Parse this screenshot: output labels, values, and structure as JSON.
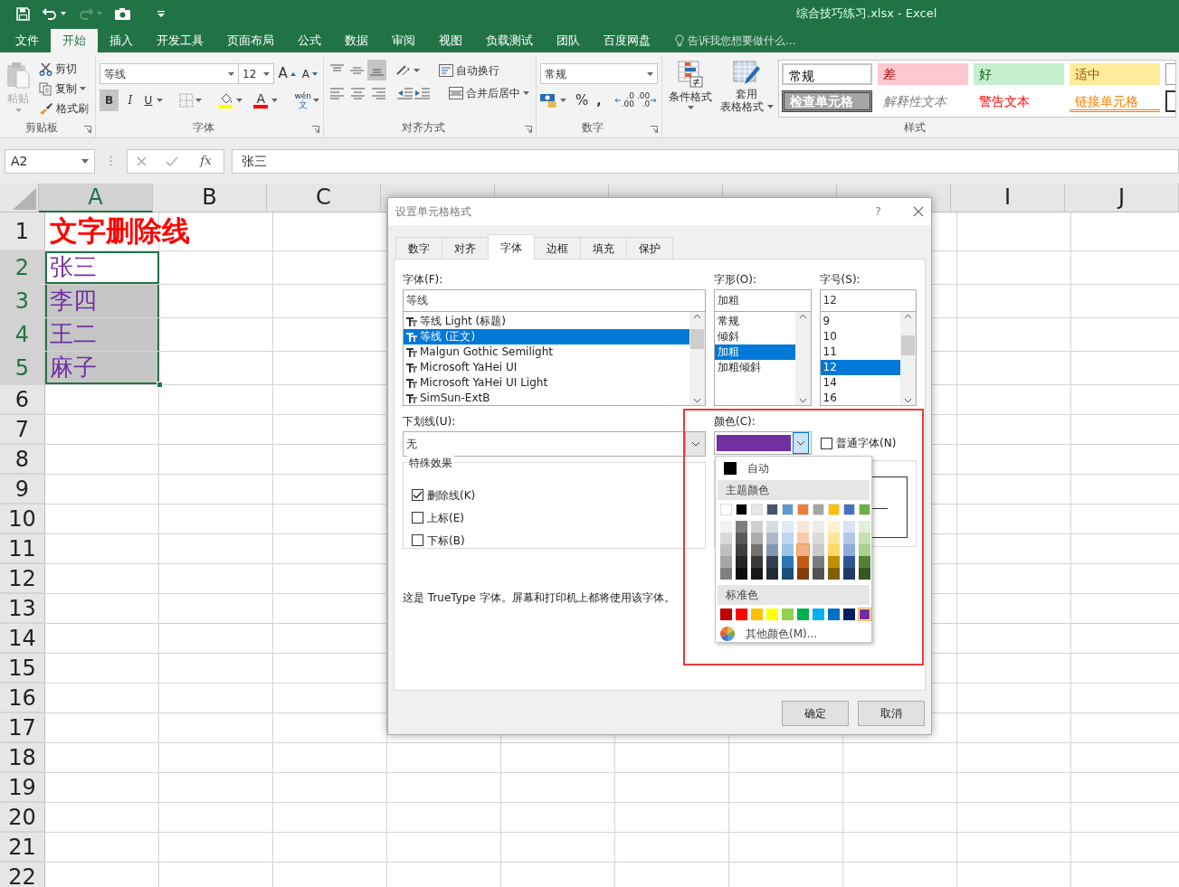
{
  "window": {
    "title": "综合技巧练习.xlsx - Excel"
  },
  "ribbon_tabs": [
    {
      "label": "文件",
      "selected": false
    },
    {
      "label": "开始",
      "selected": true
    },
    {
      "label": "插入",
      "selected": false
    },
    {
      "label": "开发工具",
      "selected": false
    },
    {
      "label": "页面布局",
      "selected": false
    },
    {
      "label": "公式",
      "selected": false
    },
    {
      "label": "数据",
      "selected": false
    },
    {
      "label": "审阅",
      "selected": false
    },
    {
      "label": "视图",
      "selected": false
    },
    {
      "label": "负载测试",
      "selected": false
    },
    {
      "label": "团队",
      "selected": false
    },
    {
      "label": "百度网盘",
      "selected": false
    }
  ],
  "tell_me": {
    "placeholder": "告诉我您想要做什么..."
  },
  "clipboard": {
    "label": "剪贴板",
    "paste": {
      "label": "粘贴",
      "disabled": true
    },
    "cut": "剪切",
    "copy": "复制",
    "format_painter": "格式刷"
  },
  "font_group": {
    "label": "字体",
    "font_name": "等线",
    "font_size": "12",
    "grow": "A",
    "shrink": "A",
    "bold": {
      "text": "B",
      "selected": true
    },
    "italic": {
      "text": "I",
      "selected": false
    },
    "underline": {
      "text": "U",
      "selected": false
    },
    "font_color": "A",
    "phonetic": {
      "pinyin": "wén",
      "character": "文"
    }
  },
  "alignment": {
    "label": "对齐方式",
    "vertical": [
      {
        "kind": "top",
        "selected": false
      },
      {
        "kind": "middle",
        "selected": false
      },
      {
        "kind": "bottom",
        "selected": true
      }
    ],
    "wrap_text": "自动换行",
    "merge_center": "合并后居中"
  },
  "number": {
    "label": "数字",
    "format": "常规",
    "percent": "%",
    "comma": ",",
    "increase_decimal": {
      "top": ".0",
      "bottom": ".00"
    },
    "decrease_decimal": {
      "top": ".00",
      "bottom": ".0"
    }
  },
  "styles": {
    "label": "样式",
    "conditional_formatting": "条件格式",
    "format_as_table": [
      "套用",
      "表格格式"
    ],
    "cells": [
      {
        "label": "常规",
        "kind": "normal"
      },
      {
        "label": "差",
        "kind": "bad"
      },
      {
        "label": "好",
        "kind": "good"
      },
      {
        "label": "适中",
        "kind": "neutral"
      },
      {
        "label": "检查单元格",
        "kind": "check"
      },
      {
        "label": "解释性文本",
        "kind": "explanatory"
      },
      {
        "label": "警告文本",
        "kind": "warning"
      },
      {
        "label": "链接单元格",
        "kind": "linked"
      }
    ]
  },
  "formula_bar": {
    "name_box": "A2",
    "function": "fx",
    "value": "张三"
  },
  "sheet": {
    "columns": [
      {
        "label": "A",
        "selected": true
      },
      {
        "label": "B",
        "selected": false
      },
      {
        "label": "C",
        "selected": false
      },
      {
        "selected": false
      },
      {
        "selected": false
      },
      {
        "selected": false
      },
      {
        "selected": false
      },
      {
        "selected": false
      },
      {
        "label": "I",
        "selected": false
      },
      {
        "label": "J",
        "selected": false
      }
    ],
    "rows": [
      {
        "header": "1",
        "selected": false,
        "cell": {
          "text": "文字删除线",
          "kind": "title",
          "color": "#ff0000",
          "active": false
        }
      },
      {
        "header": "2",
        "selected": true,
        "cell": {
          "text": "张三",
          "kind": "name",
          "color": "#7030a0",
          "active": true
        }
      },
      {
        "header": "3",
        "selected": true,
        "cell": {
          "text": "李四",
          "kind": "name",
          "color": "#7030a0",
          "active": false
        }
      },
      {
        "header": "4",
        "selected": true,
        "cell": {
          "text": "王二",
          "kind": "name",
          "color": "#7030a0",
          "active": false
        }
      },
      {
        "header": "5",
        "selected": true,
        "cell": {
          "text": "麻子",
          "kind": "name",
          "color": "#7030a0",
          "active": false
        }
      },
      {
        "header": "6",
        "selected": false
      },
      {
        "header": "7",
        "selected": false
      },
      {
        "header": "8",
        "selected": false
      },
      {
        "header": "9",
        "selected": false
      },
      {
        "header": "10",
        "selected": false
      },
      {
        "header": "11",
        "selected": false
      },
      {
        "header": "12",
        "selected": false
      },
      {
        "header": "13",
        "selected": false
      },
      {
        "header": "14",
        "selected": false
      },
      {
        "header": "15",
        "selected": false
      },
      {
        "header": "16",
        "selected": false
      },
      {
        "header": "17",
        "selected": false
      },
      {
        "header": "18",
        "selected": false
      },
      {
        "header": "19",
        "selected": false
      },
      {
        "header": "20",
        "selected": false
      },
      {
        "header": "21",
        "selected": false
      },
      {
        "header": "22",
        "selected": false
      }
    ]
  },
  "dialog": {
    "title": "设置单元格格式",
    "help": "?",
    "tabs": [
      {
        "label": "数字",
        "selected": false
      },
      {
        "label": "对齐",
        "selected": false
      },
      {
        "label": "字体",
        "selected": true
      },
      {
        "label": "边框",
        "selected": false
      },
      {
        "label": "填充",
        "selected": false
      },
      {
        "label": "保护",
        "selected": false
      }
    ],
    "font": {
      "label": "字体(F):",
      "value": "等线",
      "options": [
        {
          "label": "等线 Light (标题)",
          "selected": false
        },
        {
          "label": "等线 (正文)",
          "selected": true
        },
        {
          "label": "Malgun Gothic Semilight",
          "selected": false
        },
        {
          "label": "Microsoft YaHei UI",
          "selected": false
        },
        {
          "label": "Microsoft YaHei UI Light",
          "selected": false
        },
        {
          "label": "SimSun-ExtB",
          "selected": false
        }
      ]
    },
    "style": {
      "label": "字形(O):",
      "value": "加粗",
      "options": [
        {
          "label": "常规",
          "selected": false
        },
        {
          "label": "倾斜",
          "selected": false
        },
        {
          "label": "加粗",
          "selected": true
        },
        {
          "label": "加粗倾斜",
          "selected": false
        }
      ]
    },
    "size": {
      "label": "字号(S):",
      "value": "12",
      "options": [
        {
          "label": "9",
          "selected": false
        },
        {
          "label": "10",
          "selected": false
        },
        {
          "label": "11",
          "selected": false
        },
        {
          "label": "12",
          "selected": true
        },
        {
          "label": "14",
          "selected": false
        },
        {
          "label": "16",
          "selected": false
        }
      ]
    },
    "underline": {
      "label": "下划线(U):",
      "value": "无"
    },
    "color": {
      "label": "颜色(C):",
      "color": "#7030a0",
      "expanded": true
    },
    "normal_font": {
      "label": "普通字体(N)",
      "checked": false
    },
    "effects": {
      "legend": "特殊效果",
      "items": [
        {
          "label": "删除线(K)",
          "checked": true
        },
        {
          "label": "上标(E)",
          "checked": false
        },
        {
          "label": "下标(B)",
          "checked": false
        }
      ]
    },
    "note": "这是 TrueType 字体。屏幕和打印机上都将使用该字体。",
    "buttons": [
      "确定",
      "取消"
    ]
  },
  "color_menu": {
    "automatic": "自动",
    "theme_heading": "主题颜色",
    "theme": [
      {
        "color": "#ffffff"
      },
      {
        "color": "#000000"
      },
      {
        "color": "#e7e6e6"
      },
      {
        "color": "#44546a"
      },
      {
        "color": "#5b9bd5"
      },
      {
        "color": "#ed7d31"
      },
      {
        "color": "#a5a5a5"
      },
      {
        "color": "#ffc000"
      },
      {
        "color": "#4472c4"
      },
      {
        "color": "#70ad47"
      }
    ],
    "shades": [
      [
        {
          "color": "#f2f2f2",
          "highlighted": false
        },
        {
          "color": "#7f7f7f",
          "highlighted": false
        },
        {
          "color": "#d0cece",
          "highlighted": false
        },
        {
          "color": "#d6dce4",
          "highlighted": false
        },
        {
          "color": "#deebf6",
          "highlighted": false
        },
        {
          "color": "#fbe5d5",
          "highlighted": false
        },
        {
          "color": "#ededed",
          "highlighted": false
        },
        {
          "color": "#fff2cc",
          "highlighted": false
        },
        {
          "color": "#dae3f3",
          "highlighted": false
        },
        {
          "color": "#e2efd9",
          "highlighted": false
        }
      ],
      [
        {
          "color": "#d9d9d9",
          "highlighted": false
        },
        {
          "color": "#595959",
          "highlighted": false
        },
        {
          "color": "#aeaaaa",
          "highlighted": false
        },
        {
          "color": "#adb9ca",
          "highlighted": false
        },
        {
          "color": "#bdd7ee",
          "highlighted": false
        },
        {
          "color": "#f8cbad",
          "highlighted": false
        },
        {
          "color": "#dbdbdb",
          "highlighted": false
        },
        {
          "color": "#fee599",
          "highlighted": false
        },
        {
          "color": "#b4c7e7",
          "highlighted": false
        },
        {
          "color": "#c5e0b3",
          "highlighted": false
        }
      ],
      [
        {
          "color": "#bfbfbf",
          "highlighted": false
        },
        {
          "color": "#404040",
          "highlighted": false
        },
        {
          "color": "#757171",
          "highlighted": false
        },
        {
          "color": "#8497b0",
          "highlighted": false
        },
        {
          "color": "#9dc3e6",
          "highlighted": false
        },
        {
          "color": "#f4b183",
          "highlighted": true
        },
        {
          "color": "#c9c9c9",
          "highlighted": false
        },
        {
          "color": "#ffd965",
          "highlighted": false
        },
        {
          "color": "#8faadc",
          "highlighted": false
        },
        {
          "color": "#a8d08d",
          "highlighted": false
        }
      ],
      [
        {
          "color": "#a6a6a6",
          "highlighted": false
        },
        {
          "color": "#262626",
          "highlighted": false
        },
        {
          "color": "#3a3838",
          "highlighted": false
        },
        {
          "color": "#333f4f",
          "highlighted": false
        },
        {
          "color": "#2e75b5",
          "highlighted": false
        },
        {
          "color": "#c55a11",
          "highlighted": false
        },
        {
          "color": "#7b7b7b",
          "highlighted": false
        },
        {
          "color": "#bf9000",
          "highlighted": false
        },
        {
          "color": "#2f5597",
          "highlighted": false
        },
        {
          "color": "#538135",
          "highlighted": false
        }
      ],
      [
        {
          "color": "#808080",
          "highlighted": false
        },
        {
          "color": "#0d0d0d",
          "highlighted": false
        },
        {
          "color": "#171616",
          "highlighted": false
        },
        {
          "color": "#222b35",
          "highlighted": false
        },
        {
          "color": "#1f4e79",
          "highlighted": false
        },
        {
          "color": "#833c0b",
          "highlighted": false
        },
        {
          "color": "#525252",
          "highlighted": false
        },
        {
          "color": "#7f6000",
          "highlighted": false
        },
        {
          "color": "#203864",
          "highlighted": false
        },
        {
          "color": "#375623",
          "highlighted": false
        }
      ]
    ],
    "standard_heading": "标准色",
    "standard": [
      {
        "color": "#c00000",
        "selected": false
      },
      {
        "color": "#ff0000",
        "selected": false
      },
      {
        "color": "#ffc000",
        "selected": false
      },
      {
        "color": "#ffff00",
        "selected": false
      },
      {
        "color": "#92d050",
        "selected": false
      },
      {
        "color": "#00b050",
        "selected": false
      },
      {
        "color": "#00b0f0",
        "selected": false
      },
      {
        "color": "#0070c0",
        "selected": false
      },
      {
        "color": "#002060",
        "selected": false
      },
      {
        "color": "#7030a0",
        "selected": true
      }
    ],
    "more": "其他颜色(M)..."
  }
}
